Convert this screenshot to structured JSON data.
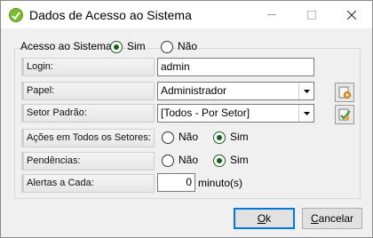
{
  "window": {
    "title": "Dados de Acesso ao Sistema"
  },
  "acesso": {
    "label": "Acesso ao Sistema:",
    "sim": "Sim",
    "nao": "Não",
    "selected": "Sim"
  },
  "login": {
    "label": "Login:",
    "value": "admin"
  },
  "papel": {
    "label": "Papel:",
    "value": "Administrador"
  },
  "setor": {
    "label": "Setor Padrão:",
    "value": "[Todos - Por Setor]"
  },
  "acoes": {
    "label": "Ações em Todos os Setores:",
    "nao": "Não",
    "sim": "Sim",
    "selected": "Sim"
  },
  "pendencias": {
    "label": "Pendências:",
    "nao": "Não",
    "sim": "Sim",
    "selected": "Sim"
  },
  "alertas": {
    "label": "Alertas a Cada:",
    "value": "0",
    "unit": "minuto(s)"
  },
  "buttons": {
    "ok_first": "O",
    "ok_rest": "k",
    "cancel_first": "C",
    "cancel_rest": "ancelar"
  },
  "colors": {
    "radio_selected": "#1b5e20",
    "default_button_border": "#0078d7",
    "app_icon": "#7dbb2e"
  }
}
